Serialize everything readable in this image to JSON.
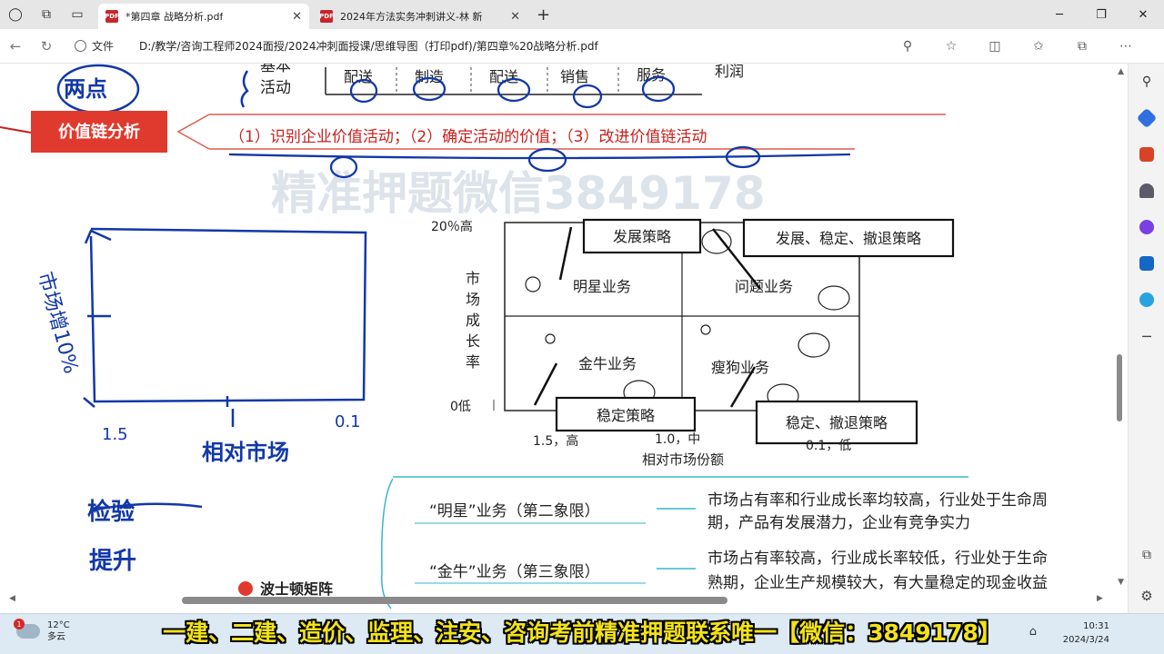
{
  "tabs": [
    {
      "title": "*第四章 战略分析.pdf",
      "active": true
    },
    {
      "title": "2024年方法实务冲刺讲义-林  新",
      "active": false
    }
  ],
  "address": {
    "file_label": "文件",
    "url": "D:/教学/咨询工程师2024面授/2024冲刺面授课/思维导图（打印pdf)/第四章%20战略分析.pdf"
  },
  "doc": {
    "top_labels": {
      "activities_line1": "基本",
      "activities_line2": "活动",
      "cols": [
        "配送",
        "制造",
        "配送",
        "销售",
        "服务",
        "利润"
      ]
    },
    "value_chain_label": "价值链分析",
    "value_chain_steps": "（1）识别企业价值活动；（2）确定活动的价值；（3）改进价值链活动",
    "watermark": "精准押题微信3849178",
    "bcg": {
      "y_top": "20％高",
      "y_bottom": "0低",
      "y_title": [
        "市",
        "场",
        "成",
        "长",
        "率"
      ],
      "quadrants": [
        "明星业务",
        "问题业务",
        "金牛业务",
        "瘦狗业务"
      ],
      "strategy_boxes": [
        "发展策略",
        "发展、稳定、撤退策略",
        "稳定策略",
        "稳定、撤退策略"
      ],
      "x_ticks": [
        "1.5，高",
        "1.0，中",
        "0.1，低"
      ],
      "x_title": "相对市场份额"
    },
    "mindmap": [
      {
        "node": "“明星”业务（第二象限）",
        "desc_line1": "市场占有率和行业成长率均较高，行业处于生命周",
        "desc_line2": "期，产品有发展潜力，企业有竞争实力"
      },
      {
        "node": "“金牛”业务（第三象限）",
        "desc_line1": "市场占有率较高，行业成长率较低，行业处于生命",
        "desc_line2": "熟期，企业生产规模较大，有大量稳定的现金收益"
      }
    ],
    "cut_heading": "波士顿矩阵",
    "handwriting": {
      "note1": "两点",
      "y_label": "市场增10%",
      "tick_left": "1.5",
      "tick_right": "0.1",
      "x_label": "相对市场",
      "note2": "检验",
      "note3": "提升"
    }
  },
  "taskbar": {
    "badge": "1",
    "temp": "12°C",
    "weather": "多云",
    "time": "10:31",
    "date": "2024/3/24"
  },
  "subtitle": "一建、二建、造价、监理、注安、咨询考前精准押题联系唯一【微信：3849178】"
}
